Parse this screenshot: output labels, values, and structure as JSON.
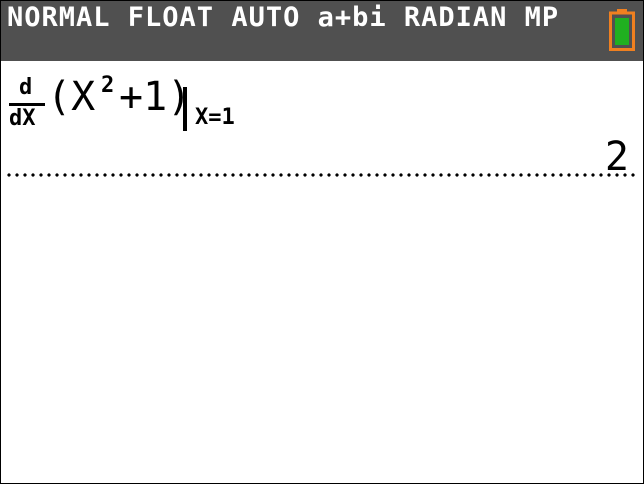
{
  "status_bar": {
    "modes": "NORMAL FLOAT AUTO a+bi RADIAN MP",
    "battery_icon": "battery-icon",
    "battery_color": "#f08020",
    "battery_level_color": "#20b020"
  },
  "history": {
    "entry": {
      "derivative_numerator": "d",
      "derivative_denominator": "dX",
      "expression_open": "(X",
      "exponent": "2",
      "expression_close": "+1)",
      "evaluated_at": "X=1"
    },
    "result": "2"
  }
}
